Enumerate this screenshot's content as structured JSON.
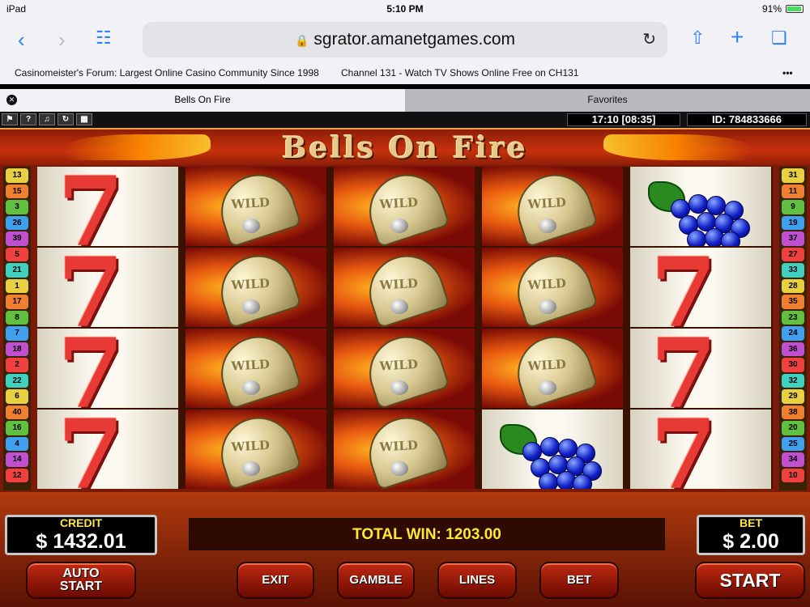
{
  "status": {
    "device": "iPad",
    "time": "5:10 PM",
    "battery": "91%"
  },
  "browser": {
    "url": "sgrator.amanetgames.com",
    "bookmarks": [
      "Casinomeister's Forum: Largest Online Casino Community Since 1998",
      "Channel 131 - Watch TV Shows Online Free on CH131"
    ],
    "more": "•••",
    "tabs": {
      "active": "Bells On Fire",
      "inactive": "Favorites"
    }
  },
  "game": {
    "clock": "17:10 [08:35]",
    "id": "ID: 784833666",
    "title": "Bells On Fire",
    "wild_label": "WILD",
    "seven_glyph": "7",
    "paylines_left": [
      "13",
      "15",
      "3",
      "26",
      "39",
      "5",
      "21",
      "1",
      "17",
      "8",
      "7",
      "18",
      "2",
      "22",
      "6",
      "40",
      "16",
      "4",
      "14",
      "12"
    ],
    "paylines_right": [
      "31",
      "11",
      "9",
      "19",
      "37",
      "27",
      "33",
      "28",
      "35",
      "23",
      "24",
      "36",
      "30",
      "32",
      "29",
      "38",
      "20",
      "25",
      "34",
      "10"
    ],
    "reels": [
      [
        "seven",
        "seven",
        "seven",
        "seven"
      ],
      [
        "bell",
        "bell",
        "bell",
        "bell"
      ],
      [
        "bell",
        "bell",
        "bell",
        "bell"
      ],
      [
        "bell",
        "bell",
        "bell",
        "grape"
      ],
      [
        "grape",
        "seven",
        "seven",
        "seven"
      ]
    ],
    "credit_label": "CREDIT",
    "credit_value": "$ 1432.01",
    "total_win": "TOTAL WIN: 1203.00",
    "bet_label": "BET",
    "bet_value": "$ 2.00",
    "buttons": {
      "auto_start": "AUTO\nSTART",
      "exit": "EXIT",
      "gamble": "GAMBLE",
      "lines": "LINES",
      "bet": "BET",
      "start": "START"
    }
  },
  "colors": {
    "payline_palette": [
      "#e8d040",
      "#f08030",
      "#60c040",
      "#40a0f0",
      "#c050d0",
      "#f04040",
      "#40d0c0"
    ]
  }
}
